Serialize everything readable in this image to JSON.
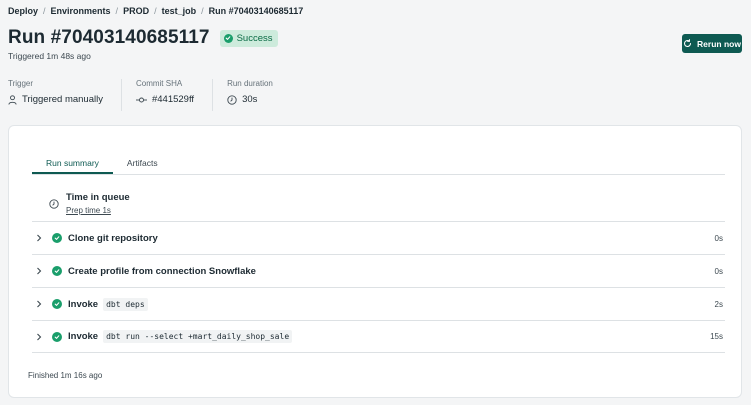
{
  "breadcrumb": {
    "items": [
      "Deploy",
      "Environments",
      "PROD",
      "test_job",
      "Run #70403140685117"
    ],
    "separator": "/"
  },
  "header": {
    "title": "Run #70403140685117",
    "status": "Success",
    "triggered": "Triggered 1m 48s ago",
    "rerun_label": "Rerun now"
  },
  "meta": {
    "trigger_label": "Trigger",
    "trigger_value": "Triggered manually",
    "commit_label": "Commit SHA",
    "commit_value": "#441529ff",
    "duration_label": "Run duration",
    "duration_value": "30s"
  },
  "tabs": [
    "Run summary",
    "Artifacts"
  ],
  "queue": {
    "title": "Time in queue",
    "prep": "Prep time 1s"
  },
  "steps": [
    {
      "name": "Clone git repository",
      "code": "",
      "duration": "0s"
    },
    {
      "name": "Create profile from connection Snowflake",
      "code": "",
      "duration": "0s"
    },
    {
      "name": "Invoke",
      "code": "dbt deps",
      "duration": "2s"
    },
    {
      "name": "Invoke",
      "code": "dbt run --select +mart_daily_shop_sale",
      "duration": "15s"
    }
  ],
  "finished": "Finished 1m 16s ago",
  "colors": {
    "accent": "#0e5a52",
    "success": "#1a9e6b",
    "success_bg": "#cdebdc"
  }
}
